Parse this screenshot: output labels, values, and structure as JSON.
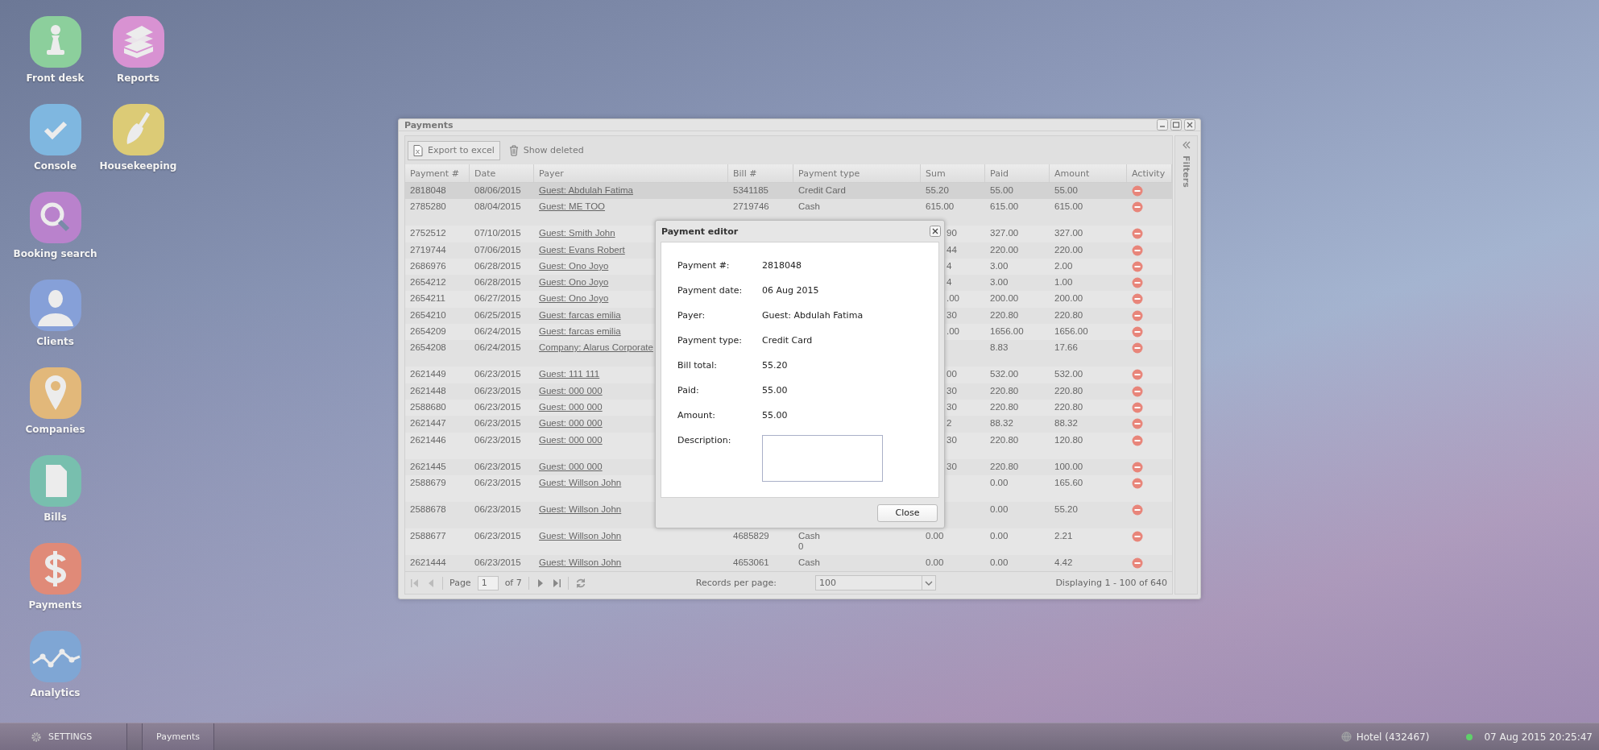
{
  "desktop_icons": [
    {
      "label": "Front desk",
      "kind": "pawn",
      "color": "#8ccf9c"
    },
    {
      "label": "Reports",
      "kind": "books",
      "color": "#d892d2"
    },
    {
      "label": "Console",
      "kind": "check",
      "color": "#7fb7e0"
    },
    {
      "label": "Housekeeping",
      "kind": "broom",
      "color": "#dccb76"
    },
    {
      "label": "Booking search",
      "kind": "magnifier",
      "color": "#b982cc"
    },
    {
      "label": "Clients",
      "kind": "person",
      "color": "#86a0d8"
    },
    {
      "label": "Companies",
      "kind": "pin",
      "color": "#e2b87a"
    },
    {
      "label": "Bills",
      "kind": "document",
      "color": "#78bfae"
    },
    {
      "label": "Payments",
      "kind": "dollar",
      "color": "#e08a78"
    },
    {
      "label": "Analytics",
      "kind": "chart",
      "color": "#7fa6d4"
    }
  ],
  "window": {
    "title": "Payments",
    "toolbar": [
      {
        "label": "Export to excel",
        "kind": "excel"
      },
      {
        "label": "Show deleted",
        "kind": "trash"
      }
    ],
    "columns": [
      "Payment #",
      "Date",
      "Payer",
      "Bill #",
      "Payment type",
      "Sum",
      "Paid",
      "Amount",
      "Activity"
    ],
    "rows": [
      {
        "payment_no": "2818048",
        "date": "08/06/2015",
        "payer": "Guest: Abdulah Fatima",
        "bill": "5341185",
        "payment_type": "Credit Card",
        "sum": "55.20",
        "paid": "55.00",
        "amount": "55.00",
        "selected": true,
        "tall": false,
        "under_dialog": false
      },
      {
        "payment_no": "2785280",
        "date": "08/04/2015",
        "payer": "Guest: ME TOO",
        "bill": "2719746",
        "payment_type": "Cash",
        "sum": "615.00",
        "paid": "615.00",
        "amount": "615.00",
        "selected": false,
        "tall": true,
        "under_dialog": false
      },
      {
        "payment_no": "2752512",
        "date": "07/10/2015",
        "payer": "Guest: Smith John",
        "sum": "90",
        "paid": "327.00",
        "amount": "327.00",
        "selected": false,
        "tall": false,
        "under_dialog": true
      },
      {
        "payment_no": "2719744",
        "date": "07/06/2015",
        "payer": "Guest: Evans Robert",
        "sum": "44",
        "paid": "220.00",
        "amount": "220.00",
        "selected": false,
        "tall": false,
        "under_dialog": true
      },
      {
        "payment_no": "2686976",
        "date": "06/28/2015",
        "payer": "Guest: Ono Joyo",
        "sum": "4",
        "paid": "3.00",
        "amount": "2.00",
        "selected": false,
        "tall": false,
        "under_dialog": true
      },
      {
        "payment_no": "2654212",
        "date": "06/28/2015",
        "payer": "Guest: Ono Joyo",
        "sum": "4",
        "paid": "3.00",
        "amount": "1.00",
        "selected": false,
        "tall": false,
        "under_dialog": true
      },
      {
        "payment_no": "2654211",
        "date": "06/27/2015",
        "payer": "Guest: Ono Joyo",
        "sum": ".00",
        "paid": "200.00",
        "amount": "200.00",
        "selected": false,
        "tall": false,
        "under_dialog": true
      },
      {
        "payment_no": "2654210",
        "date": "06/25/2015",
        "payer": "Guest: farcas emilia",
        "sum": "30",
        "paid": "220.80",
        "amount": "220.80",
        "selected": false,
        "tall": false,
        "under_dialog": true
      },
      {
        "payment_no": "2654209",
        "date": "06/24/2015",
        "payer": "Guest: farcas emilia",
        "sum": ".00",
        "paid": "1656.00",
        "amount": "1656.00",
        "selected": false,
        "tall": false,
        "under_dialog": true
      },
      {
        "payment_no": "2654208",
        "date": "06/24/2015",
        "payer": "Company: Alarus Corporate",
        "paid": "8.83",
        "amount": "17.66",
        "selected": false,
        "tall": true
      },
      {
        "payment_no": "2621449",
        "date": "06/23/2015",
        "payer": "Guest: 111 111",
        "sum": "00",
        "paid": "532.00",
        "amount": "532.00",
        "selected": false,
        "tall": false,
        "under_dialog": true
      },
      {
        "payment_no": "2621448",
        "date": "06/23/2015",
        "payer": "Guest: 000 000",
        "sum": "30",
        "paid": "220.80",
        "amount": "220.80",
        "selected": false,
        "tall": false,
        "under_dialog": true
      },
      {
        "payment_no": "2588680",
        "date": "06/23/2015",
        "payer": "Guest: 000 000",
        "sum": "30",
        "paid": "220.80",
        "amount": "220.80",
        "selected": false,
        "tall": false,
        "under_dialog": true
      },
      {
        "payment_no": "2621447",
        "date": "06/23/2015",
        "payer": "Guest: 000 000",
        "sum": "2",
        "paid": "88.32",
        "amount": "88.32",
        "selected": false,
        "tall": false,
        "under_dialog": true
      },
      {
        "payment_no": "2621446",
        "date": "06/23/2015",
        "payer": "Guest: 000 000",
        "sum": "30",
        "paid": "220.80",
        "amount": "120.80",
        "selected": false,
        "tall": true,
        "under_dialog": true
      },
      {
        "payment_no": "2621445",
        "date": "06/23/2015",
        "payer": "Guest: 000 000",
        "sum": "30",
        "paid": "220.80",
        "amount": "100.00",
        "selected": false,
        "tall": false,
        "under_dialog": true
      },
      {
        "payment_no": "2588679",
        "date": "06/23/2015",
        "payer": "Guest: Willson John",
        "paid": "0.00",
        "amount": "165.60",
        "selected": false,
        "tall": true
      },
      {
        "payment_no": "2588678",
        "date": "06/23/2015",
        "payer": "Guest: Willson John",
        "paid": "0.00",
        "amount": "55.20",
        "selected": false,
        "tall": true
      },
      {
        "payment_no": "2588677",
        "date": "06/23/2015",
        "payer": "Guest: Willson John",
        "bill": "4685829",
        "payment_type": "Cash\n0",
        "sum": "0.00",
        "paid": "0.00",
        "amount": "2.21",
        "selected": false,
        "tall": true,
        "under_dialog": false
      },
      {
        "payment_no": "2621444",
        "date": "06/23/2015",
        "payer": "Guest: Willson John",
        "bill": "4653061",
        "payment_type": "Cash",
        "sum": "0.00",
        "paid": "0.00",
        "amount": "4.42",
        "selected": false,
        "tall": false,
        "under_dialog": false
      }
    ],
    "pager": {
      "page_label": "Page",
      "page": "1",
      "of": "of 7",
      "records_label": "Records per page:",
      "records": "100",
      "displaying": "Displaying 1 - 100 of 640"
    },
    "filters_label": "Filters"
  },
  "dialog": {
    "title": "Payment editor",
    "fields": [
      {
        "label": "Payment #:",
        "value": "2818048",
        "kind": "text"
      },
      {
        "label": "Payment date:",
        "value": "06 Aug 2015",
        "kind": "text"
      },
      {
        "label": "Payer:",
        "value": "Guest: Abdulah Fatima",
        "kind": "text"
      },
      {
        "label": "Payment type:",
        "value": "Credit Card",
        "kind": "text"
      },
      {
        "label": "Bill total:",
        "value": "55.20",
        "kind": "text"
      },
      {
        "label": "Paid:",
        "value": "55.00",
        "kind": "text"
      },
      {
        "label": "Amount:",
        "value": "55.00",
        "kind": "text"
      },
      {
        "label": "Description:",
        "kind": "textarea"
      }
    ],
    "close_button": "Close"
  },
  "taskbar": {
    "settings": "SETTINGS",
    "tasks": [
      "Payments"
    ],
    "hotel": "Hotel (432467)",
    "datetime": "07 Aug 2015 20:25:47"
  }
}
